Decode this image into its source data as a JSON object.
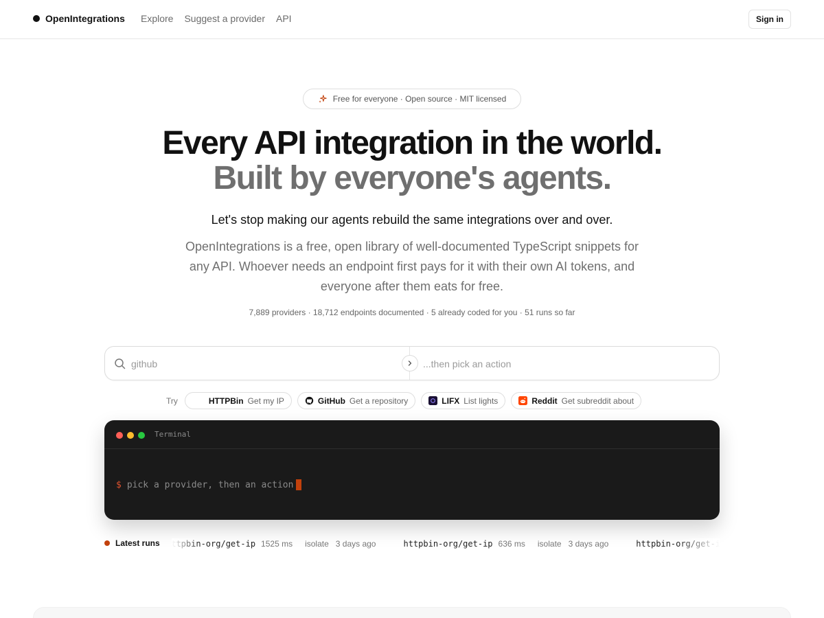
{
  "header": {
    "brand": "OpenIntegrations",
    "nav": [
      "Explore",
      "Suggest a provider",
      "API"
    ],
    "signin_label": "Sign in"
  },
  "hero": {
    "pill": "Free for everyone · Open source · MIT licensed",
    "headline": "Every API integration in the world.",
    "subheadline": "Built by everyone's agents.",
    "lead": "Let's stop making our agents rebuild the same integrations over and over.",
    "description": "OpenIntegrations is a free, open library of well-documented TypeScript snippets for any API. Whoever needs an endpoint first pays for it with their own AI tokens, and everyone after them eats for free.",
    "stats": "7,889 providers · 18,712 endpoints documented · 5 already coded for you · 51 runs so far"
  },
  "search": {
    "provider_placeholder": "github",
    "action_placeholder": "...then pick an action"
  },
  "try": {
    "label": "Try",
    "chips": [
      {
        "name": "HTTPBin",
        "action": "Get my IP",
        "icon": "httpbin-icon"
      },
      {
        "name": "GitHub",
        "action": "Get a repository",
        "icon": "github-icon"
      },
      {
        "name": "LIFX",
        "action": "List lights",
        "icon": "lifx-icon"
      },
      {
        "name": "Reddit",
        "action": "Get subreddit about",
        "icon": "reddit-icon"
      }
    ]
  },
  "terminal": {
    "title": "Terminal",
    "prompt": "$",
    "command": "pick a provider, then an action"
  },
  "latest_runs": {
    "label": "Latest runs",
    "runs": [
      {
        "path": "httpbin-org/get-ip",
        "ms": "1525 ms",
        "env": "isolate",
        "when": "3 days ago"
      },
      {
        "path": "httpbin-org/get-ip",
        "ms": "636 ms",
        "env": "isolate",
        "when": "3 days ago"
      },
      {
        "path": "httpbin-org/get-ip",
        "ms": "",
        "env": "",
        "when": ""
      }
    ]
  },
  "colors": {
    "accent": "#c2410c",
    "terminal_bg": "#1a1a1a",
    "muted_text": "#6f6f6f"
  }
}
